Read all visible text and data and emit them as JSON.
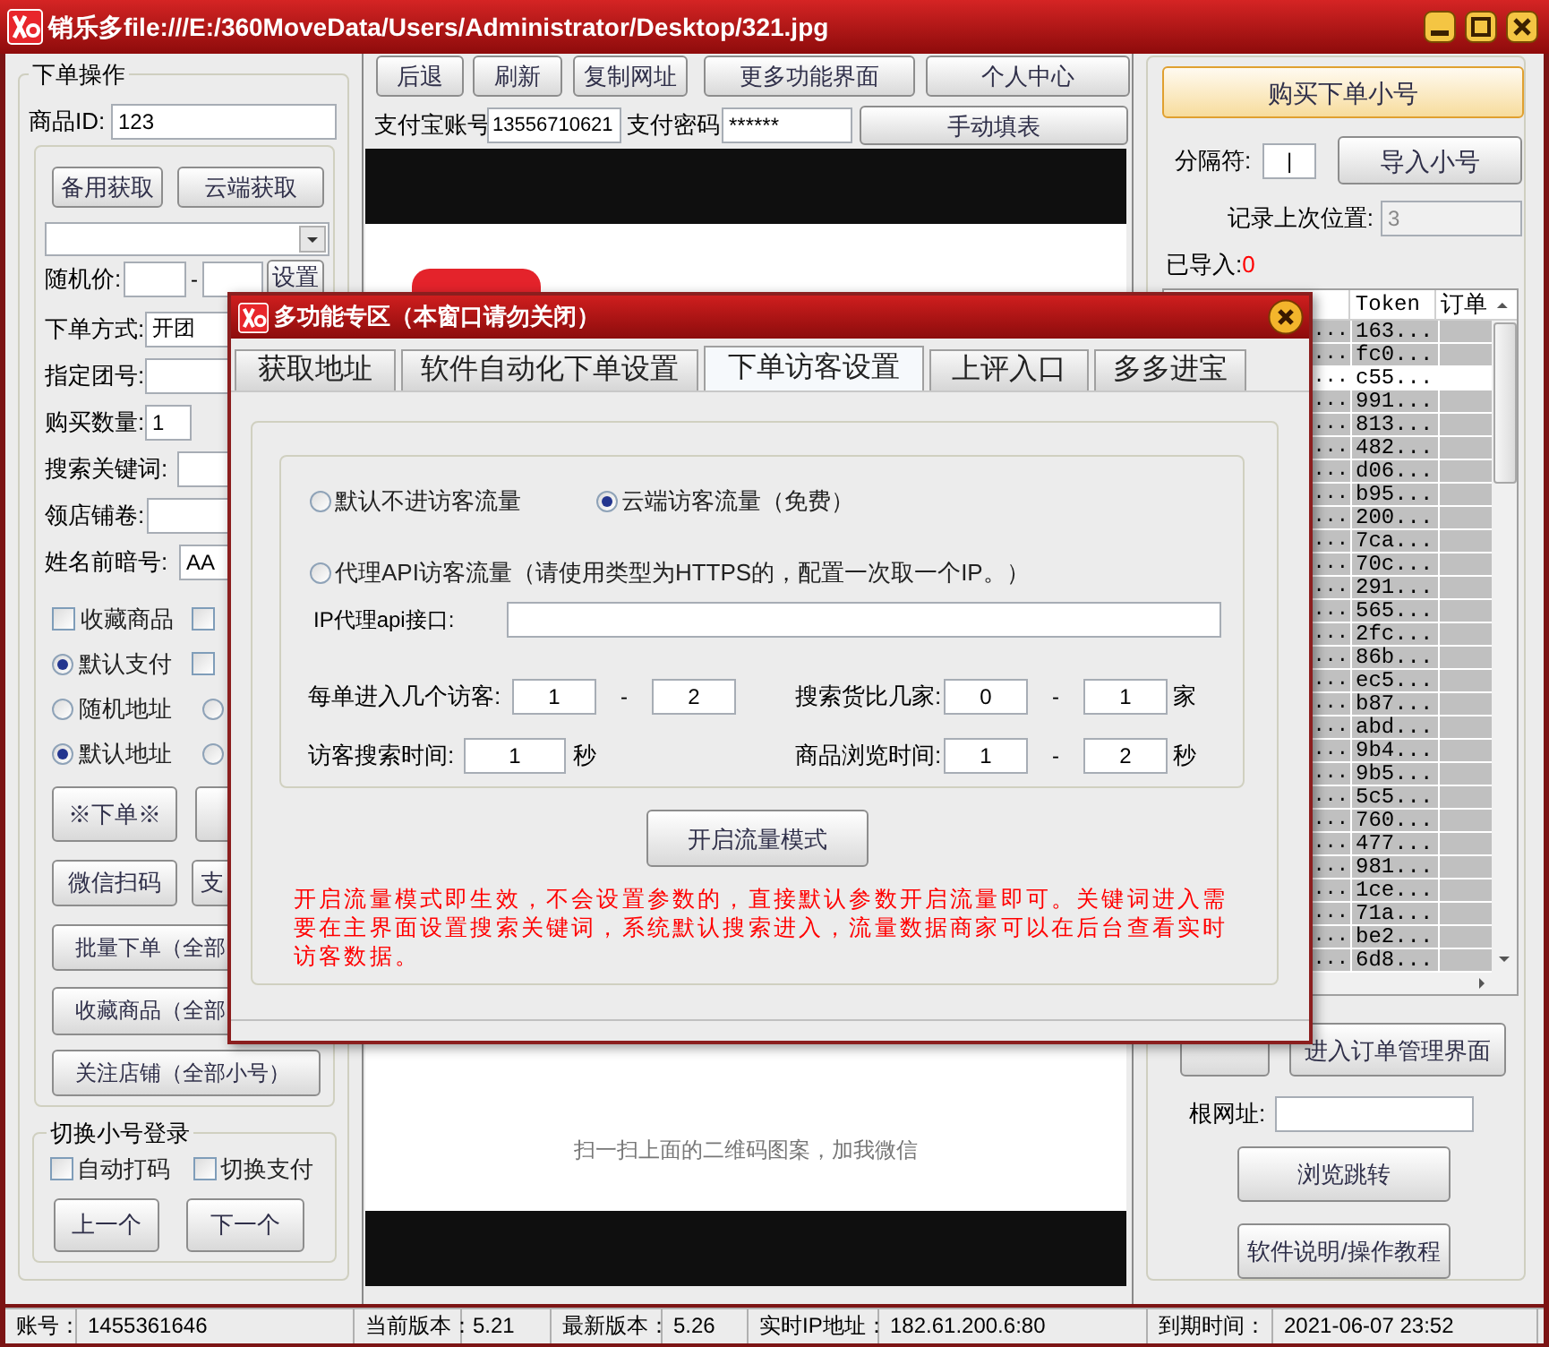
{
  "window": {
    "title": "销乐多file:///E:/360MoveData/Users/Administrator/Desktop/321.jpg"
  },
  "order_panel": {
    "title": "下单操作",
    "product_id": {
      "label": "商品ID:",
      "value": "123"
    },
    "fetch_buttons": [
      "备用获取",
      "云端获取"
    ],
    "random_price": {
      "label": "随机价:",
      "separator": "-",
      "button": "设置"
    },
    "fields": [
      {
        "label": "下单方式:",
        "value": "开团"
      },
      {
        "label": "指定团号:"
      },
      {
        "label": "购买数量:",
        "value": "1"
      },
      {
        "label": "搜索关键词:"
      },
      {
        "label": "领店铺卷:"
      },
      {
        "label": "姓名前暗号:",
        "value": "AA"
      }
    ],
    "options": [
      [
        {
          "kind": "checkbox",
          "label": "收藏商品",
          "checked": false
        },
        {
          "kind": "checkbox",
          "checked": false
        }
      ],
      [
        {
          "kind": "radio",
          "label": "默认支付",
          "selected": true
        },
        {
          "kind": "checkbox",
          "checked": false
        }
      ],
      [
        {
          "kind": "radio",
          "label": "随机地址",
          "selected": false
        },
        {
          "kind": "radio",
          "selected": false
        }
      ],
      [
        {
          "kind": "radio",
          "label": "默认地址",
          "selected": true
        },
        {
          "kind": "radio",
          "selected": false
        }
      ]
    ],
    "action_buttons": [
      [
        {
          "kind": "button",
          "label": "※下单※"
        },
        {
          "kind": "button"
        }
      ],
      [
        {
          "kind": "button",
          "label": "微信扫码"
        },
        {
          "kind": "button",
          "label": "支"
        }
      ],
      [
        {
          "kind": "button",
          "label": "批量下单（全部"
        }
      ],
      [
        {
          "kind": "button",
          "label": "收藏商品（全部"
        }
      ],
      [
        {
          "kind": "button",
          "label": "关注店铺（全部小号）"
        }
      ]
    ],
    "account_switch": {
      "title": "切换小号登录",
      "options": [
        {
          "label": "自动打码",
          "checked": false
        },
        {
          "label": "切换支付",
          "checked": false
        }
      ],
      "buttons": [
        "上一个",
        "下一个"
      ]
    }
  },
  "browser": {
    "toolbar": [
      "后退",
      "刷新",
      "复制网址",
      "更多功能界面",
      "个人中心"
    ],
    "alipay_account": {
      "label": "支付宝账号",
      "value": "13556710621"
    },
    "alipay_password": {
      "label": "支付密码",
      "value": "******"
    },
    "fill_button": "手动填表",
    "caption": "扫一扫上面的二维码图案，加我微信"
  },
  "accounts_panel": {
    "buy_button": "购买下单小号",
    "separator": {
      "label": "分隔符:",
      "value": "|"
    },
    "import_button": "导入小号",
    "last_position": {
      "label": "记录上次位置:",
      "value": "3",
      "disabled": true
    },
    "imported": {
      "label": "已导入:",
      "count": "0"
    },
    "table": {
      "columns": [
        "Token",
        "订单"
      ],
      "rows": [
        {
          "column_1": "...",
          "token": "163...",
          "selected": true
        },
        {
          "column_1": "...",
          "token": "fc0...",
          "selected": true
        },
        {
          "column_1": "...",
          "token": "c55...",
          "selected": false
        },
        {
          "column_1": "...",
          "token": "991...",
          "selected": true
        },
        {
          "column_1": "...",
          "token": "813...",
          "selected": true
        },
        {
          "column_1": "...",
          "token": "482...",
          "selected": true
        },
        {
          "column_1": "...",
          "token": "d06...",
          "selected": true
        },
        {
          "column_1": "...",
          "token": "b95...",
          "selected": true
        },
        {
          "column_1": "...",
          "token": "200...",
          "selected": true
        },
        {
          "column_1": "...",
          "token": "7ca...",
          "selected": true
        },
        {
          "column_1": "...",
          "token": "70c...",
          "selected": true
        },
        {
          "column_1": "...",
          "token": "291...",
          "selected": true
        },
        {
          "column_1": "...",
          "token": "565...",
          "selected": true
        },
        {
          "column_1": "...",
          "token": "2fc...",
          "selected": true
        },
        {
          "column_1": "...",
          "token": "86b...",
          "selected": true
        },
        {
          "column_1": "...",
          "token": "ec5...",
          "selected": true
        },
        {
          "column_1": "...",
          "token": "b87...",
          "selected": true
        },
        {
          "column_1": "...",
          "token": "abd...",
          "selected": true
        },
        {
          "column_1": "...",
          "token": "9b4...",
          "selected": true
        },
        {
          "column_1": "...",
          "token": "9b5...",
          "selected": true
        },
        {
          "column_1": "...",
          "token": "5c5...",
          "selected": true
        },
        {
          "column_1": "...",
          "token": "760...",
          "selected": true
        },
        {
          "column_1": "...",
          "token": "477...",
          "selected": true
        },
        {
          "column_1": "...",
          "token": "981...",
          "selected": true
        },
        {
          "column_1": "...",
          "token": "1ce...",
          "selected": true
        },
        {
          "column_1": "...",
          "token": "71a...",
          "selected": true
        },
        {
          "column_1": "...",
          "token": "be2...",
          "selected": true
        },
        {
          "column_1": "...",
          "token": "6d8...",
          "selected": true
        }
      ]
    },
    "buttons": [
      {
        "kind": "button"
      },
      {
        "kind": "button",
        "label": "进入订单管理界面"
      }
    ],
    "root_url": {
      "label": "根网址:"
    },
    "browse_button": "浏览跳转",
    "help_button": "软件说明/操作教程"
  },
  "dialog": {
    "title": "多功能专区（本窗口请勿关闭）",
    "tabs": [
      {
        "label": "获取地址",
        "selected": false
      },
      {
        "label": "软件自动化下单设置",
        "selected": false
      },
      {
        "label": "下单访客设置",
        "selected": true
      },
      {
        "label": "上评入口",
        "selected": false
      },
      {
        "label": "多多进宝",
        "selected": false
      }
    ],
    "traffic_modes": [
      {
        "label": "默认不进访客流量",
        "selected": false
      },
      {
        "label": "云端访客流量（免费）",
        "selected": true
      },
      {
        "label": "代理API访客流量（请使用类型为HTTPS的，配置一次取一个IP。）",
        "selected": false
      }
    ],
    "ip_api": {
      "label": "IP代理api接口:"
    },
    "visitors_per_order": {
      "label": "每单进入几个访客:",
      "min": "1",
      "separator": "-",
      "max": "2"
    },
    "compare_shops": {
      "label": "搜索货比几家:",
      "min": "0",
      "separator": "-",
      "max": "1",
      "unit": "家"
    },
    "search_time": {
      "label": "访客搜索时间:",
      "value": "1",
      "unit": "秒"
    },
    "browse_time": {
      "label": "商品浏览时间:",
      "min": "1",
      "separator": "-",
      "max": "2",
      "unit": "秒"
    },
    "start_button": "开启流量模式",
    "notice": "开启流量模式即生效，不会设置参数的，直接默认参数开启流量即可。关键词进入需要在主界面设置搜索关键词，系统默认搜索进入，流量数据商家可以在后台查看实时访客数据。"
  },
  "status_bar": [
    {
      "label": "账号：",
      "value": "1455361646"
    },
    {
      "label": "当前版本：",
      "value": "5.21"
    },
    {
      "label": "最新版本：",
      "value": "5.26"
    },
    {
      "label": "实时IP地址：",
      "value": "182.61.200.6:80"
    },
    {
      "label": "到期时间：",
      "value": "2021-06-07 23:52"
    }
  ]
}
